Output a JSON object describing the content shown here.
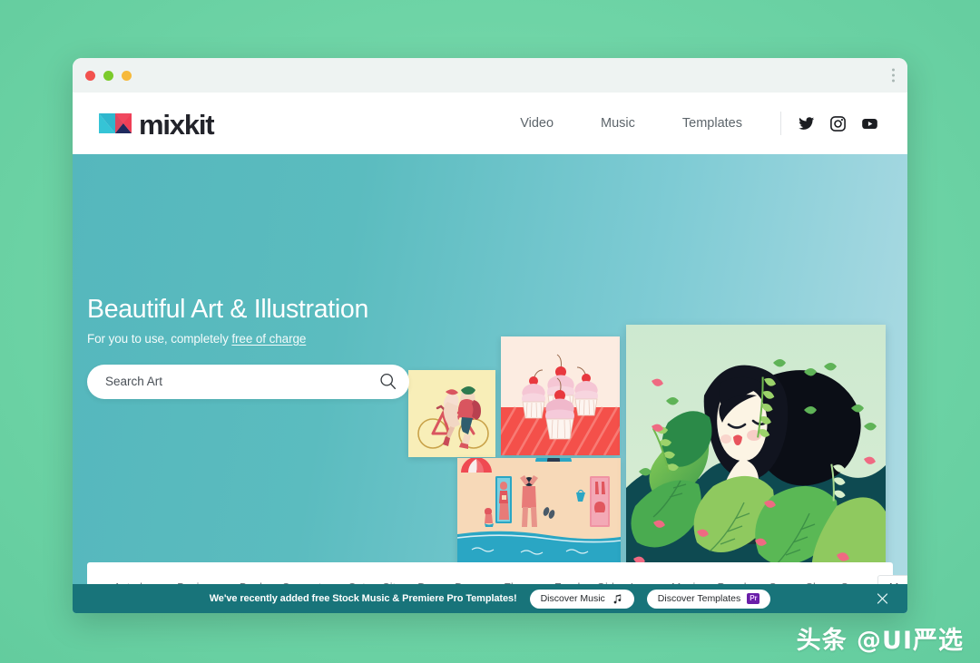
{
  "theme": {
    "page_background": "#6ed4a6",
    "hero_gradient_start": "#55b7bd",
    "hero_gradient_end": "#aedbe4",
    "banner_background": "#18747a",
    "logo_teal": "#35c4d6",
    "logo_pink": "#ef3e56",
    "pr_badge_purple": "#6a1ea8"
  },
  "window": {
    "traffic_lights": [
      "close",
      "minimize",
      "maximize"
    ],
    "menu_icon": "kebab-menu-icon"
  },
  "header": {
    "logo_text": "mixkit",
    "nav": [
      {
        "label": "Video"
      },
      {
        "label": "Music"
      },
      {
        "label": "Templates"
      }
    ],
    "socials": [
      {
        "name": "twitter-icon"
      },
      {
        "name": "instagram-icon"
      },
      {
        "name": "youtube-icon"
      }
    ]
  },
  "hero": {
    "title": "Beautiful Art & Illustration",
    "subtitle_prefix": "For you to use, completely ",
    "subtitle_link": "free of charge",
    "search": {
      "placeholder": "Search Art",
      "value": "",
      "icon": "search-icon"
    },
    "artwork": [
      {
        "name": "cyclist-illustration",
        "caption": "Two cyclists on a bicycle on pale yellow background"
      },
      {
        "name": "cupcakes-illustration",
        "caption": "Cherry-topped cupcakes on a red striped tablecloth"
      },
      {
        "name": "beach-illustration",
        "caption": "Overhead beach scene with sunbathers and umbrellas"
      },
      {
        "name": "forest-girl-illustration",
        "caption": "Girl with long black hair among green tropical leaves"
      }
    ]
  },
  "tagbar": {
    "tags": [
      "Astrology",
      "Business",
      "Book",
      "Computer",
      "Cat",
      "City",
      "Dog",
      "Dance",
      "Flower",
      "Food",
      "Girl",
      "Love",
      "Music",
      "People",
      "Sea",
      "Sky",
      "Snow"
    ],
    "more_label": "More",
    "more_chevron": "›"
  },
  "banner": {
    "message": "We've recently added free Stock Music & Premiere Pro Templates!",
    "buttons": [
      {
        "label": "Discover Music",
        "icon": "music-note-icon"
      },
      {
        "label": "Discover Templates",
        "icon": "premiere-pro-badge",
        "badge_text": "Pr"
      }
    ],
    "close_icon": "close-icon"
  },
  "watermark": {
    "text": "头条 @UI严选"
  }
}
